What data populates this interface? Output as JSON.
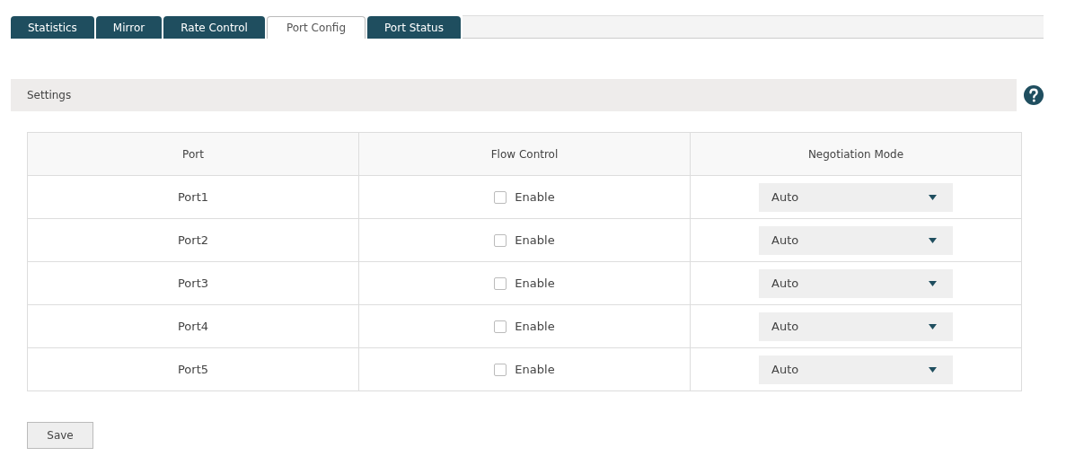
{
  "tabs": [
    {
      "label": "Statistics",
      "selected": false
    },
    {
      "label": "Mirror",
      "selected": false
    },
    {
      "label": "Rate Control",
      "selected": false
    },
    {
      "label": "Port Config",
      "selected": true
    },
    {
      "label": "Port Status",
      "selected": false
    }
  ],
  "section": {
    "title": "Settings"
  },
  "table": {
    "columns": [
      "Port",
      "Flow Control",
      "Negotiation Mode"
    ],
    "rows": [
      {
        "port": "Port1",
        "flow_control": {
          "checked": false,
          "label": "Enable"
        },
        "negotiation_mode": "Auto"
      },
      {
        "port": "Port2",
        "flow_control": {
          "checked": false,
          "label": "Enable"
        },
        "negotiation_mode": "Auto"
      },
      {
        "port": "Port3",
        "flow_control": {
          "checked": false,
          "label": "Enable"
        },
        "negotiation_mode": "Auto"
      },
      {
        "port": "Port4",
        "flow_control": {
          "checked": false,
          "label": "Enable"
        },
        "negotiation_mode": "Auto"
      },
      {
        "port": "Port5",
        "flow_control": {
          "checked": false,
          "label": "Enable"
        },
        "negotiation_mode": "Auto"
      }
    ]
  },
  "buttons": [
    "Save"
  ]
}
